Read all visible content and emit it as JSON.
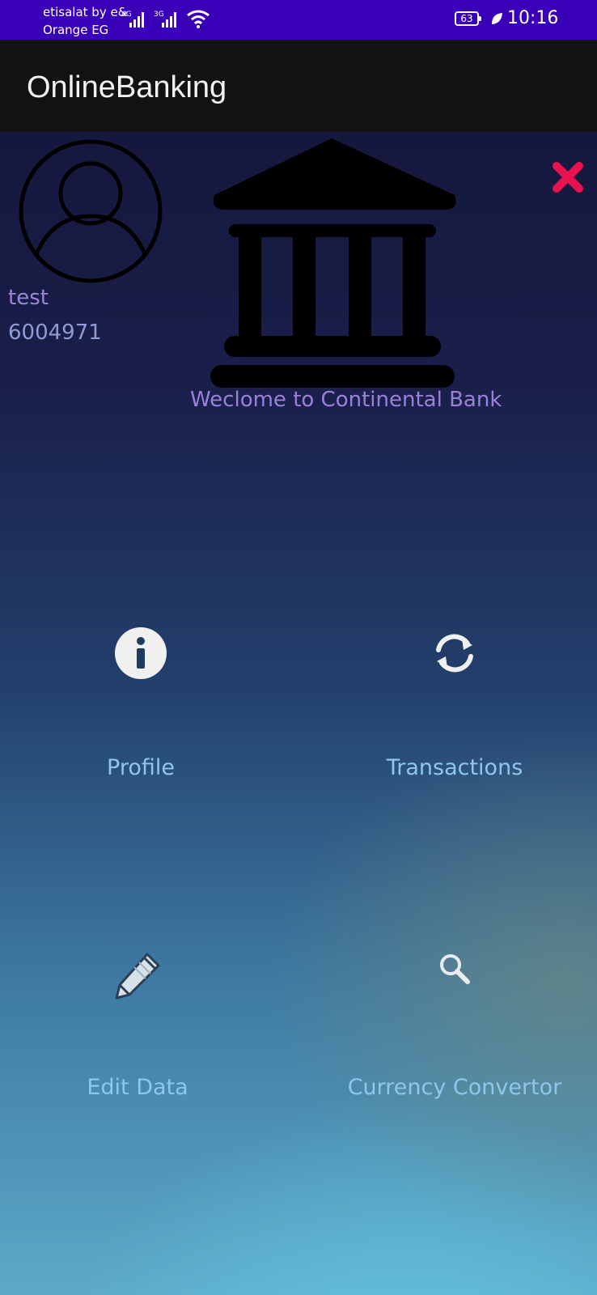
{
  "status_bar": {
    "carrier_line1": "etisalat by e&",
    "carrier_line2": "Orange EG",
    "net1": "4G",
    "net2": "3G",
    "battery": "63",
    "time": "10:16"
  },
  "app_bar": {
    "title": "OnlineBanking"
  },
  "user": {
    "name": "test",
    "account_number": "6004971"
  },
  "welcome": "Weclome to Continental Bank",
  "menu": [
    {
      "label": "Profile",
      "icon": "info-icon"
    },
    {
      "label": "Transactions",
      "icon": "refresh-icon"
    },
    {
      "label": "Edit Data",
      "icon": "pencil-icon"
    },
    {
      "label": "Currency Convertor",
      "icon": "search-icon"
    }
  ],
  "colors": {
    "status_bar": "#3a00b8",
    "app_bar": "#121212",
    "close": "#e8124f",
    "menu_label": "#8fc6ee"
  }
}
